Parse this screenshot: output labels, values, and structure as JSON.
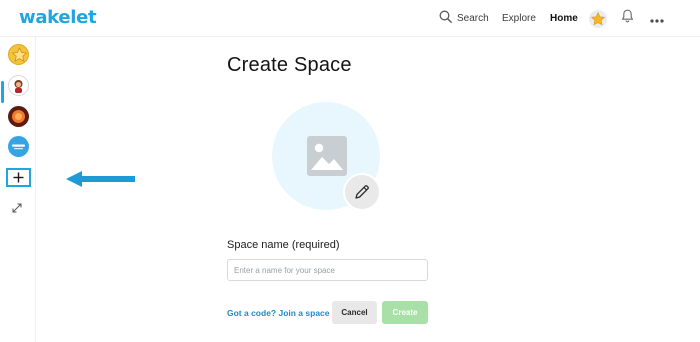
{
  "header": {
    "logo": "wakelet",
    "search_label": "Search",
    "explore_label": "Explore",
    "home_label": "Home"
  },
  "sidebar": {
    "avatars": [
      {
        "name": "star-collection-avatar",
        "color": "#f2c43a"
      },
      {
        "name": "character-avatar",
        "color": "#ffffff"
      },
      {
        "name": "orange-logo-avatar",
        "color": "#5a1b10"
      },
      {
        "name": "blue-logo-avatar",
        "color": "#35a3e4"
      }
    ],
    "add_icon": "plus-icon",
    "expand_icon": "expand-icon"
  },
  "main": {
    "title": "Create Space",
    "field_label": "Space name (required)",
    "field_placeholder": "Enter a name for your space",
    "field_value": "",
    "join_link": "Got a code? Join a space",
    "cancel_label": "Cancel",
    "create_label": "Create"
  },
  "colors": {
    "brand": "#1fa6e0",
    "cover_bg": "#e8f6fd",
    "create_disabled": "#a8e0a8",
    "arrow": "#1e9ad6"
  }
}
